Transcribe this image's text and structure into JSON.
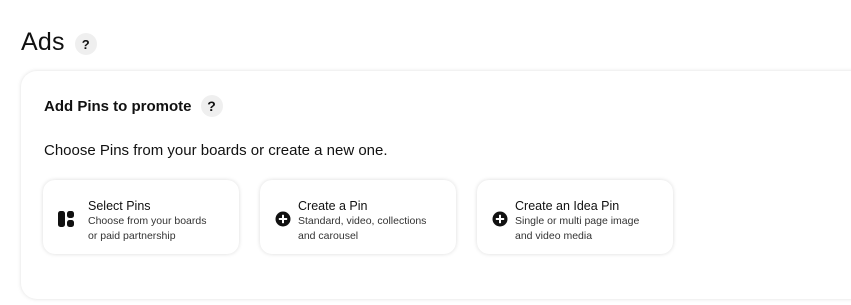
{
  "header": {
    "title": "Ads",
    "help_label": "?"
  },
  "panel": {
    "title": "Add Pins to promote",
    "help_label": "?",
    "subtitle": "Choose Pins from your boards or create a new one."
  },
  "options": [
    {
      "title": "Select Pins",
      "desc_line1": "Choose from your boards",
      "desc_line2": "or paid partnership",
      "icon": "grid-icon"
    },
    {
      "title": "Create a Pin",
      "desc_line1": "Standard, video, collections",
      "desc_line2": "and carousel",
      "icon": "plus-circle-icon"
    },
    {
      "title": "Create an Idea Pin",
      "desc_line1": "Single or multi page image",
      "desc_line2": "and video media",
      "icon": "plus-circle-icon"
    }
  ]
}
